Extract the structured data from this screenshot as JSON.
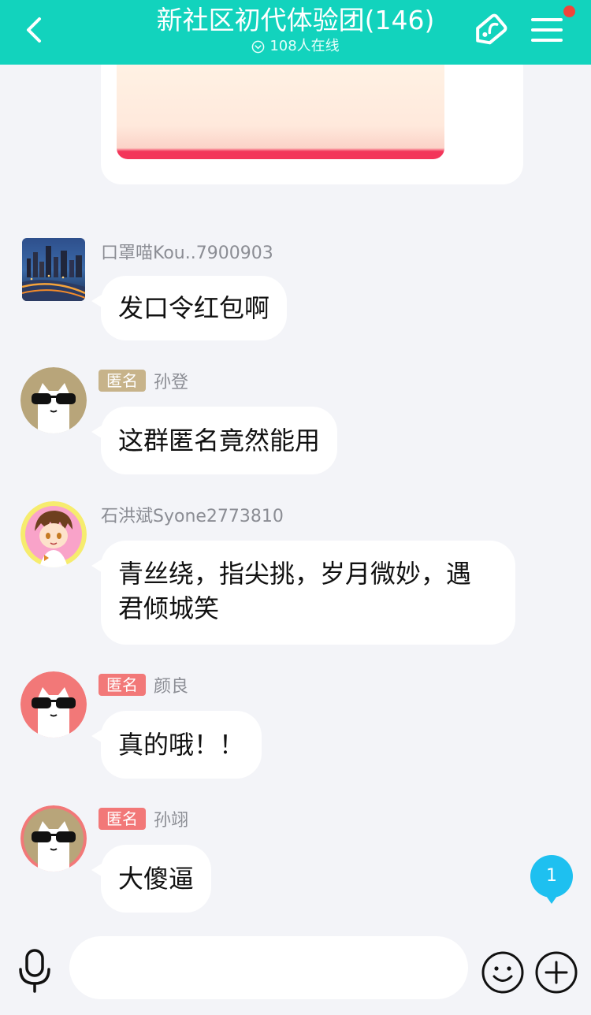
{
  "header": {
    "title": "新社区初代体验团(146)",
    "online": "108人在线"
  },
  "messages": [
    {
      "sender": "口罩喵Kou..7900903",
      "text": "发口令红包啊"
    },
    {
      "anon_tag": "匿名",
      "sender": "孙登",
      "text": "这群匿名竟然能用"
    },
    {
      "sender": "石洪斌Syone2773810",
      "text_line1": "青丝绕，指尖挑，岁月微妙，遇",
      "text_line2": "君倾城笑"
    },
    {
      "anon_tag": "匿名",
      "sender": "颜良",
      "text": "真的哦！！"
    },
    {
      "anon_tag": "匿名",
      "sender": "孙翊",
      "text": "大傻逼"
    }
  ],
  "unread_count": "1",
  "input": {
    "value": "",
    "placeholder": ""
  },
  "colors": {
    "header_bg": "#12d3bd",
    "anon_tag_gold": "#c7b38a",
    "anon_tag_pink": "#f27878",
    "unread_badge": "#1ec0f0",
    "notification_dot": "#f0453a"
  }
}
